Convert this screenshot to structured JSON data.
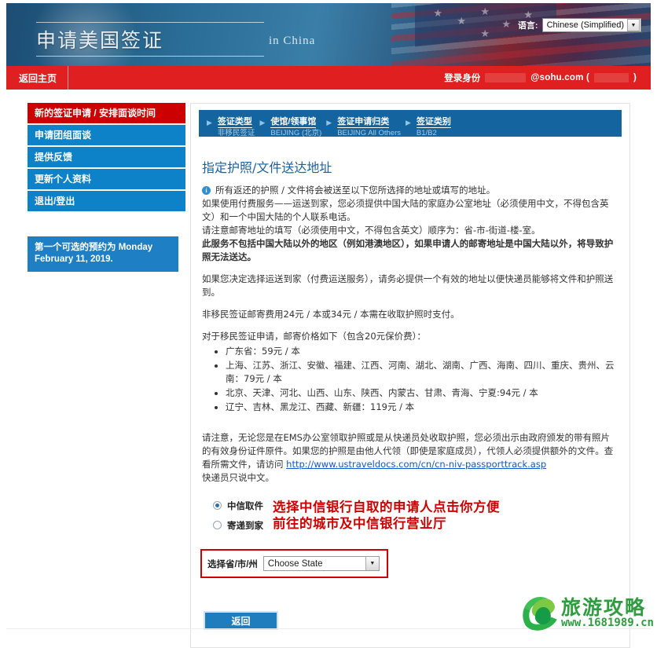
{
  "header": {
    "title": "申请美国签证",
    "subtitle": "in China",
    "language_label": "语言:",
    "language_value": "Chinese (Simplified)",
    "caret": "▼"
  },
  "navbar": {
    "home_label": "返回主页",
    "login_label": "登录身份",
    "user_email": "@sohu.com (",
    "user_email_suffix": ")"
  },
  "sidebar": {
    "items": [
      {
        "label": "新的签证申请 / 安排面谈时间",
        "active": true
      },
      {
        "label": "申请团组面谈",
        "active": false
      },
      {
        "label": "提供反馈",
        "active": false
      },
      {
        "label": "更新个人资料",
        "active": false
      },
      {
        "label": "退出/登出",
        "active": false
      }
    ],
    "note": "第一个可选的预约为 Monday February 11, 2019."
  },
  "steps": [
    {
      "title": "签证类型",
      "sub": "非移民签证",
      "arrow": "▶"
    },
    {
      "title": "使馆/领事馆",
      "sub": "BEIJING (北京)",
      "arrow": "▶"
    },
    {
      "title": "签证申请归类",
      "sub": "BEIJING All Others",
      "arrow": "▶"
    },
    {
      "title": "签证类别",
      "sub": "B1/B2",
      "arrow": "▶"
    }
  ],
  "main": {
    "section_title": "指定护照/文件送达地址",
    "info_icon": "i",
    "info_text": "所有返还的护照 / 文件将会被送至以下您所选择的地址或填写的地址。",
    "para_1": "如果使用付费服务——运送到家，您必须提供中国大陆的家庭办公室地址（必须使用中文，不得包含英文）和一个中国大陆的个人联系电话。",
    "para_2": "请注意邮寄地址的填写（必须使用中文，不得包含英文）顺序为：省-市-街道-楼-室。",
    "para_3_bold": "此服务不包括中国大陆以外的地区（例如港澳地区），如果申请人的邮寄地址是中国大陆以外，将导致护照无法送达。",
    "para_4": "如果您决定选择运送到家（付费运送服务），请务必提供一个有效的地址以便快递员能够将文件和护照送到。",
    "para_5": "非移民签证邮寄费用24元 / 本或34元 / 本需在收取护照时支付。",
    "para_6": "对于移民签证申请，邮寄价格如下（包含20元保价费）：",
    "price_list": [
      "广东省：59元 / 本",
      "上海、江苏、浙江、安徽、福建、江西、河南、湖北、湖南、广西、海南、四川、重庆、贵州、云南：79元 / 本",
      "北京、天津、河北、山西、山东、陕西、内蒙古、甘肃、青海、宁夏:94元 / 本",
      "辽宁、吉林、黑龙江、西藏、新疆：119元 / 本"
    ],
    "para_7": "请注意，无论您是在EMS办公室领取护照或是从快递员处收取护照，您必须出示由政府颁发的带有照片的有效身份证件原件。如果您的护照是由他人代领（即使是家庭成员），代领人必须提供额外的文件。查看所需文件，请访问",
    "link_url": "http://www.ustraveldocs.com/cn/cn-niv-passporttrack.asp",
    "para_8": "快递员只说中文。",
    "radio_options": [
      {
        "label": "中信取件",
        "selected": true
      },
      {
        "label": "寄递到家",
        "selected": false
      }
    ],
    "annotation_line_1": "选择中信银行自取的申请人点击你方便",
    "annotation_line_2": "前往的城市及中信银行营业厅",
    "state_label": "选择省/市/州",
    "state_value": "Choose State",
    "state_caret": "▼",
    "back_button": "返回"
  },
  "watermark": {
    "text_cn": "旅游攻略",
    "url": "www.1681989.cn"
  }
}
